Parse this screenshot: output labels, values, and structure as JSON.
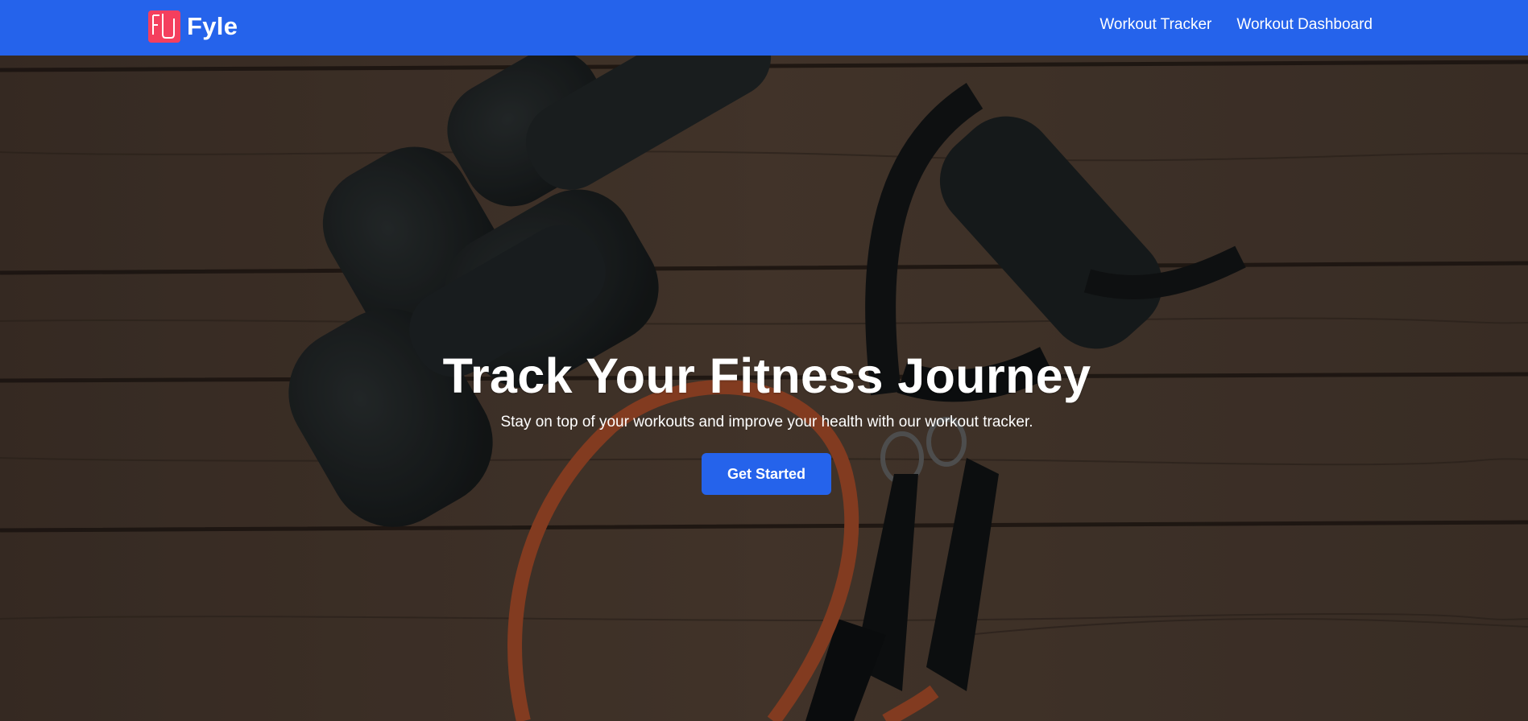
{
  "brand": {
    "name": "Fyle",
    "logo_icon": "fyle-logo-icon",
    "logo_color": "#f43f5e"
  },
  "nav": {
    "background": "#2563eb",
    "links": [
      "Workout Tracker",
      "Workout Dashboard"
    ]
  },
  "hero": {
    "title": "Track Your Fitness Journey",
    "subtitle": "Stay on top of your workouts and improve your health with our workout tracker.",
    "cta_label": "Get Started",
    "cta_color": "#2563eb",
    "background_image": "dumbbells-and-resistance-band-on-wooden-floor"
  }
}
